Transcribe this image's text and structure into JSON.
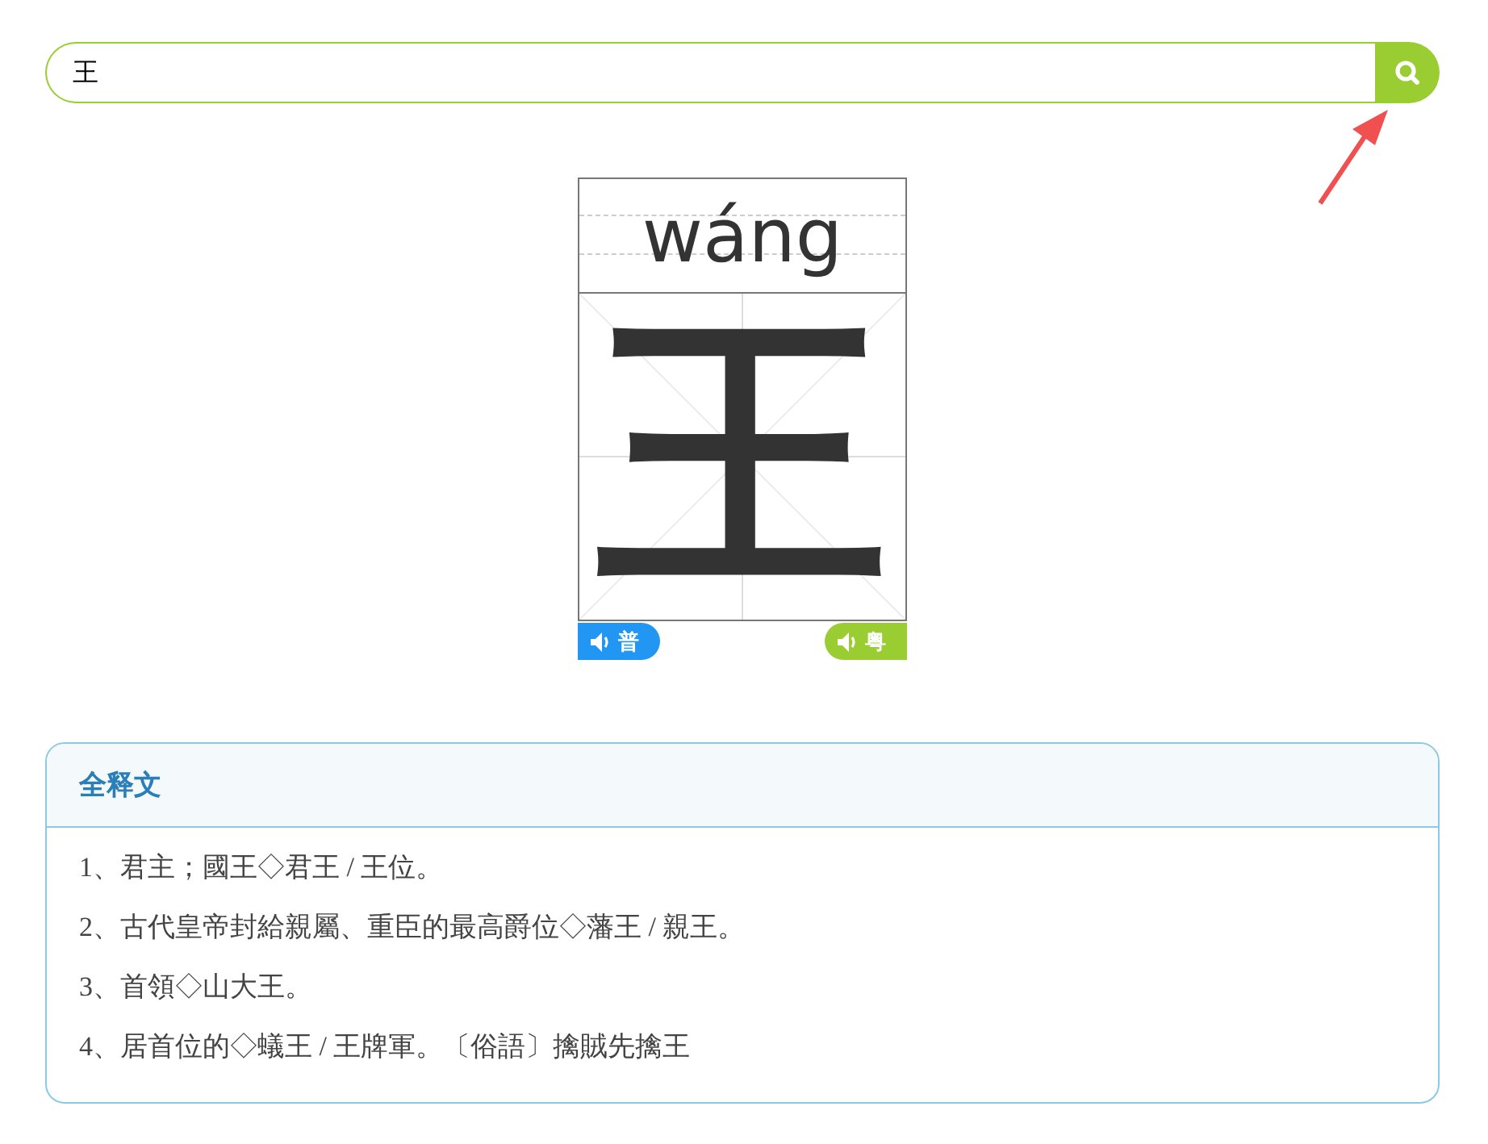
{
  "search": {
    "value": "王"
  },
  "card": {
    "pinyin": "wáng",
    "character": "王",
    "buttons": [
      {
        "label": "普",
        "kind": "mandarin"
      },
      {
        "label": "粤",
        "kind": "cantonese"
      }
    ]
  },
  "definitions": {
    "title": "全释文",
    "items": [
      "1、君主；國王◇君王 / 王位。",
      "2、古代皇帝封給親屬、重臣的最高爵位◇藩王 / 親王。",
      "3、首領◇山大王。",
      "4、居首位的◇蟻王 / 王牌軍。〔俗語〕擒賊先擒王"
    ]
  }
}
